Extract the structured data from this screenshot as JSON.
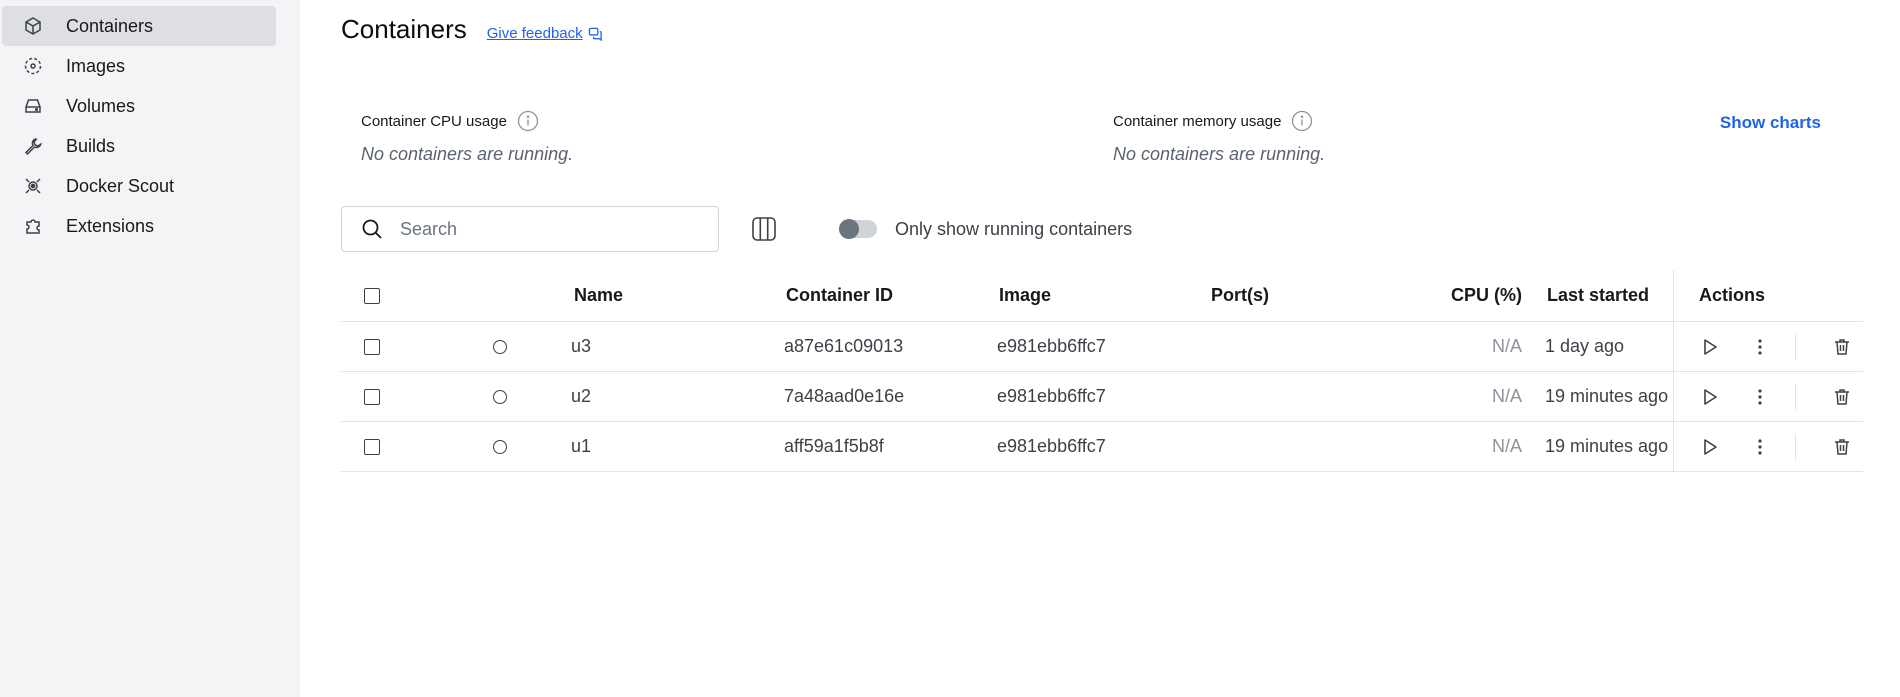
{
  "sidebar": {
    "items": [
      {
        "label": "Containers",
        "icon": "box-icon"
      },
      {
        "label": "Images",
        "icon": "images-icon"
      },
      {
        "label": "Volumes",
        "icon": "volume-icon"
      },
      {
        "label": "Builds",
        "icon": "wrench-icon"
      },
      {
        "label": "Docker Scout",
        "icon": "scout-icon"
      },
      {
        "label": "Extensions",
        "icon": "puzzle-icon"
      }
    ],
    "active": "Containers"
  },
  "header": {
    "title": "Containers",
    "feedback": "Give feedback"
  },
  "usage": {
    "cpu_label": "Container CPU usage",
    "cpu_value": "No containers are running.",
    "mem_label": "Container memory usage",
    "mem_value": "No containers are running.",
    "show_charts": "Show charts"
  },
  "toolbar": {
    "search_placeholder": "Search",
    "toggle_label": "Only show running containers",
    "toggle_on": false
  },
  "table": {
    "headers": {
      "name": "Name",
      "container_id": "Container ID",
      "image": "Image",
      "ports": "Port(s)",
      "cpu": "CPU (%)",
      "last_started": "Last started",
      "actions": "Actions"
    },
    "rows": [
      {
        "name": "u3",
        "container_id": "a87e61c09013",
        "image": "e981ebb6ffc7",
        "ports": "",
        "cpu": "N/A",
        "last_started": "1 day ago"
      },
      {
        "name": "u2",
        "container_id": "7a48aad0e16e",
        "image": "e981ebb6ffc7",
        "ports": "",
        "cpu": "N/A",
        "last_started": "19 minutes ago"
      },
      {
        "name": "u1",
        "container_id": "aff59a1f5b8f",
        "image": "e981ebb6ffc7",
        "ports": "",
        "cpu": "N/A",
        "last_started": "19 minutes ago"
      }
    ]
  },
  "colors": {
    "accent": "#1d63ed",
    "sidebar_bg": "#f4f4f6",
    "sidebar_active": "#dddfe4"
  }
}
